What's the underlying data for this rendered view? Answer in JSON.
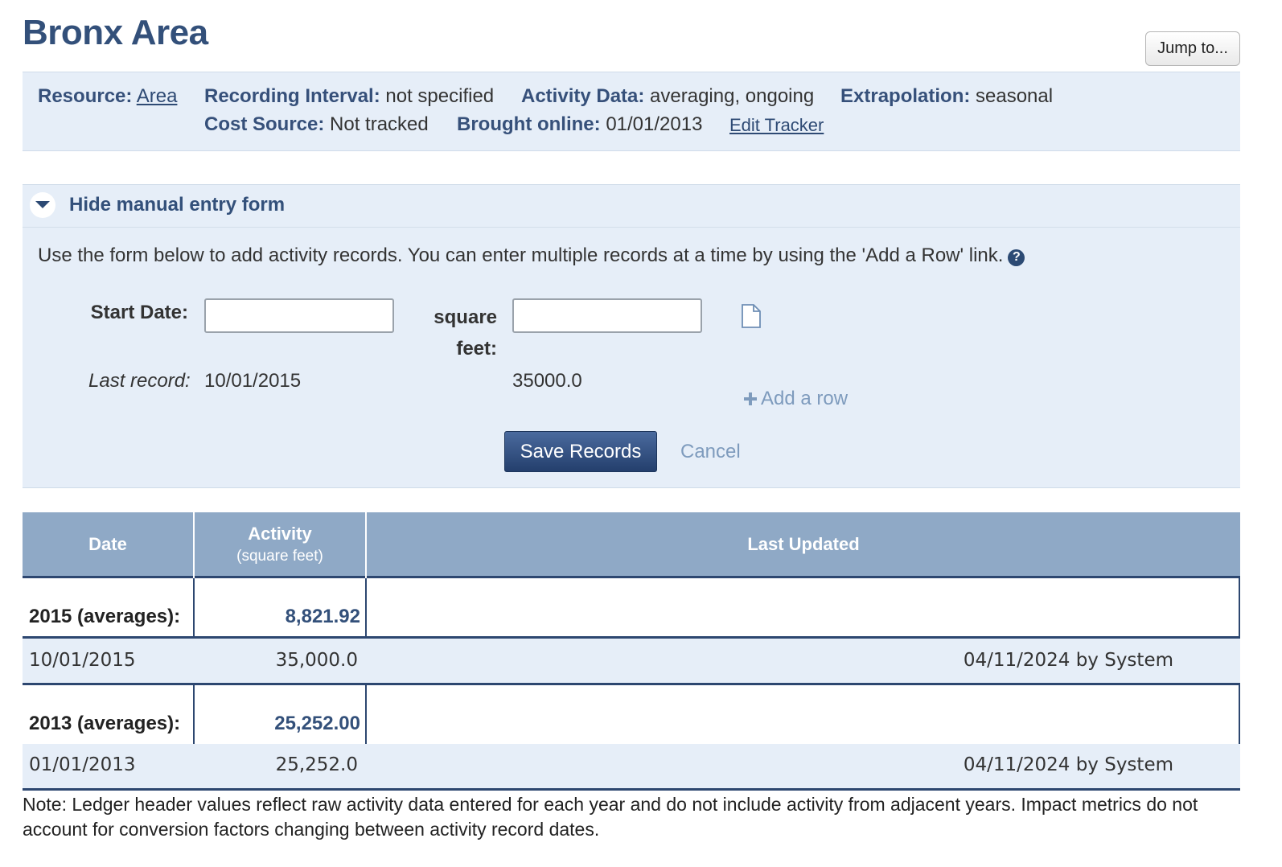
{
  "page": {
    "title": "Bronx Area",
    "jump_label": "Jump to..."
  },
  "info": {
    "resource_label": "Resource:",
    "resource_value": "Area",
    "interval_label": "Recording Interval:",
    "interval_value": "not specified",
    "activity_label": "Activity Data:",
    "activity_value": "averaging, ongoing",
    "extrapolation_label": "Extrapolation:",
    "extrapolation_value": "seasonal",
    "cost_label": "Cost Source:",
    "cost_value": "Not tracked",
    "online_label": "Brought online:",
    "online_value": "01/01/2013",
    "edit_link": "Edit Tracker"
  },
  "form": {
    "toggle_label": "Hide manual entry form",
    "instructions": "Use the form below to add activity records. You can enter multiple records at a time by using the 'Add a Row' link.",
    "help_glyph": "?",
    "start_date_label": "Start Date:",
    "start_date_value": "",
    "sqft_label_line1": "square",
    "sqft_label_line2": "feet:",
    "sqft_value": "",
    "last_record_label": "Last record:",
    "last_record_date": "10/01/2015",
    "last_record_value": "35000.0",
    "add_row_label": "Add a row",
    "save_label": "Save Records",
    "cancel_label": "Cancel"
  },
  "ledger": {
    "headers": {
      "date": "Date",
      "activity": "Activity",
      "activity_unit": "(square feet)",
      "last_updated": "Last Updated"
    },
    "groups": [
      {
        "year_label": "2015 (averages):",
        "average": "8,821.92",
        "records": [
          {
            "date": "10/01/2015",
            "value": "35,000.0",
            "updated": "04/11/2024 by System"
          }
        ]
      },
      {
        "year_label": "2013 (averages):",
        "average": "25,252.00",
        "records": [
          {
            "date": "01/01/2013",
            "value": "25,252.0",
            "updated": "04/11/2024 by System"
          }
        ]
      }
    ]
  },
  "note": "Note: Ledger header values reflect raw activity data entered for each year and do not include activity from adjacent years. Impact metrics do not account for conversion factors changing between activity record dates.",
  "icons": {
    "toggle": "chevron-down-icon",
    "help": "help-icon",
    "document": "document-icon",
    "add": "plus-icon"
  },
  "colors": {
    "title": "#33507a",
    "panel_bg": "#e6eef8",
    "table_header": "#8fa9c6",
    "table_rule": "#2d4770",
    "muted_link": "#7e9bbd"
  }
}
